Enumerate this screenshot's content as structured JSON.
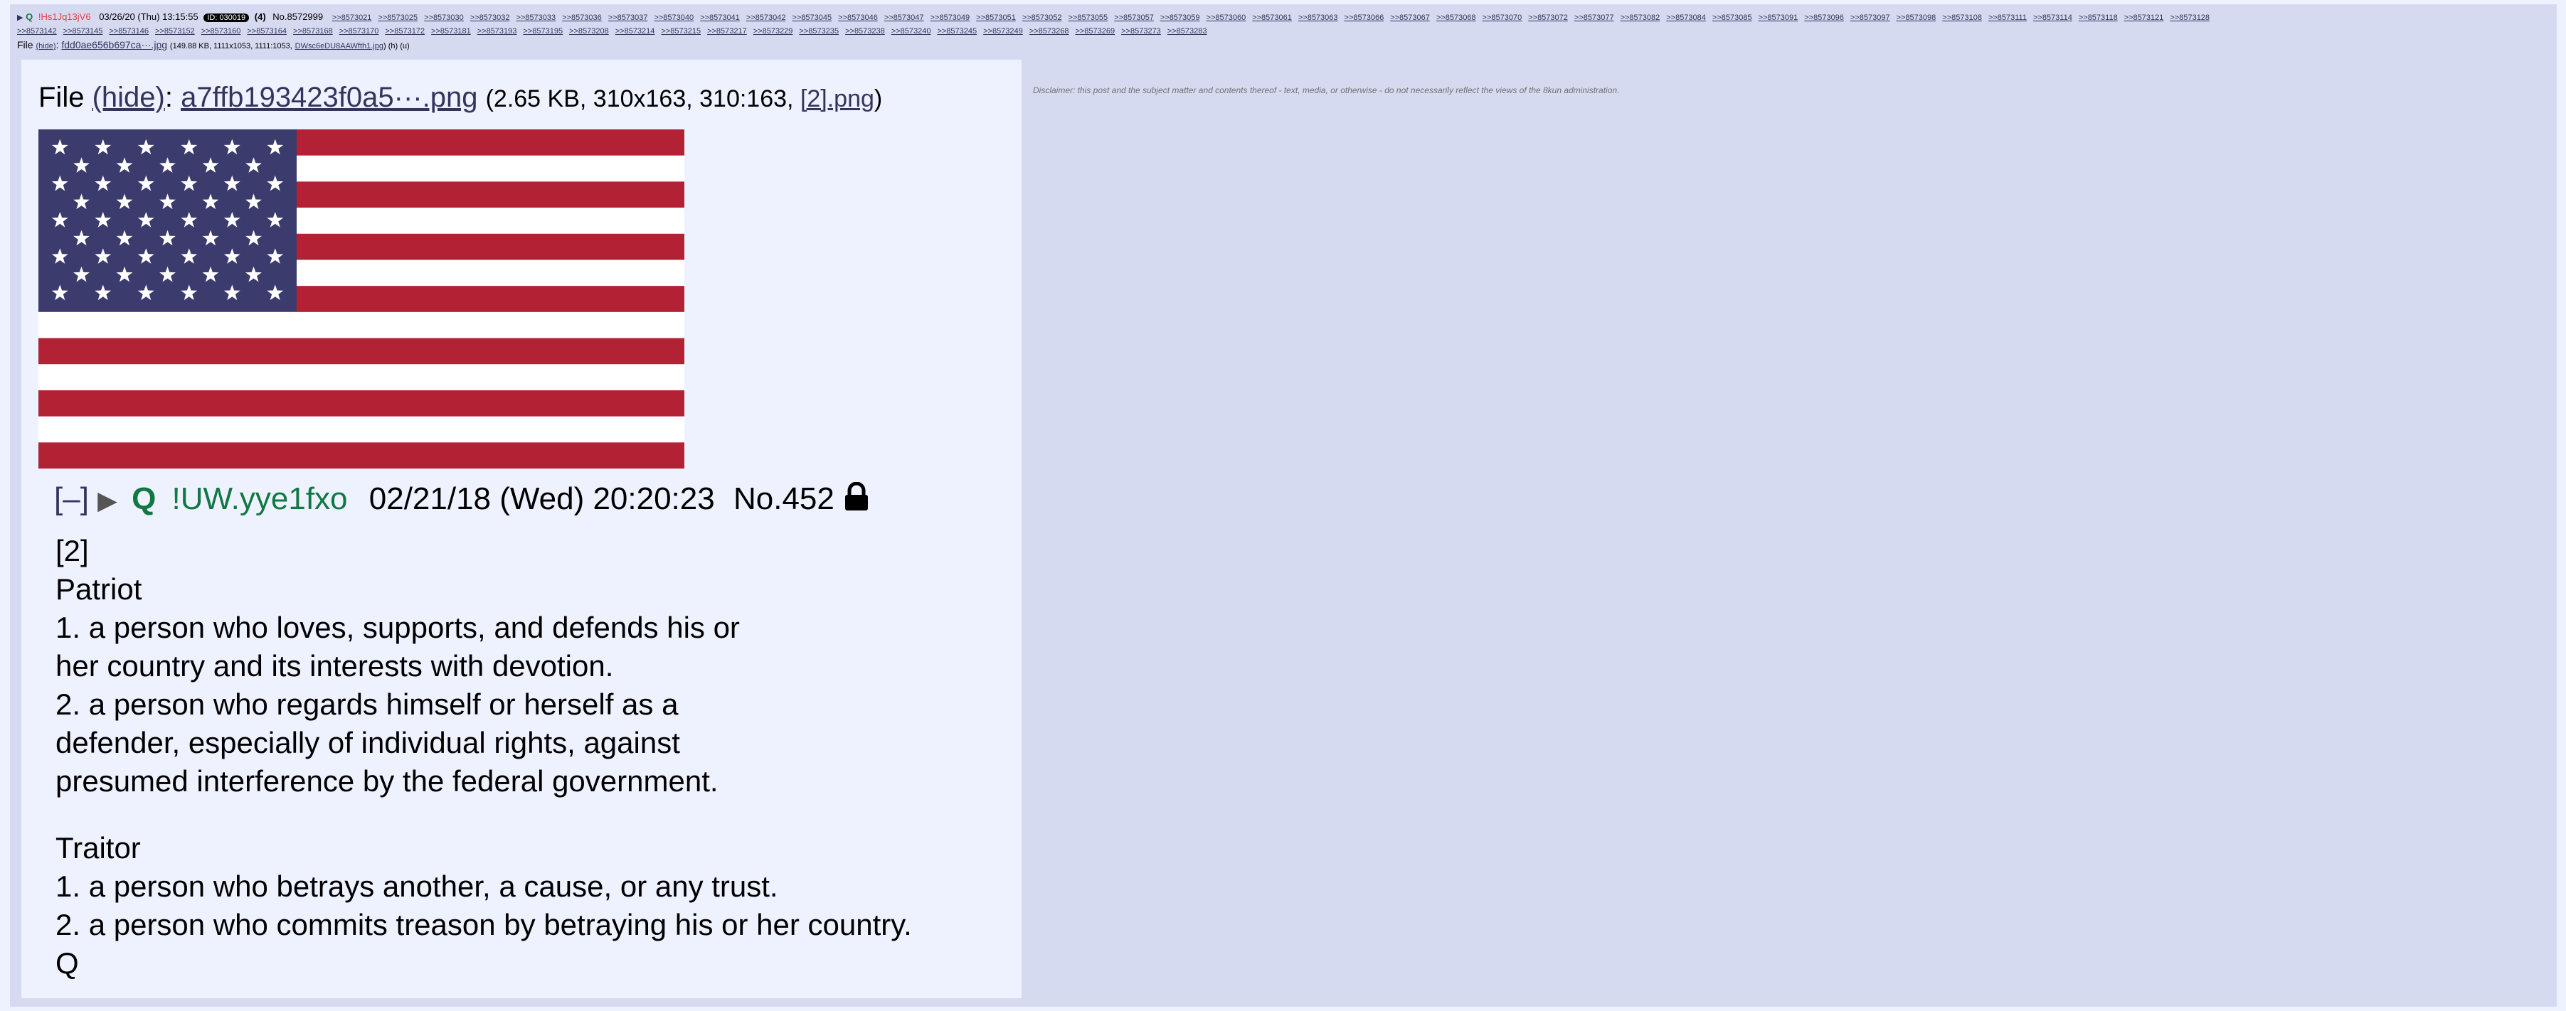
{
  "header": {
    "trip": "!Hs1Jq13jV6",
    "q_marker": "Q",
    "date": "03/26/20 (Thu) 13:15:55",
    "id_badge": "ID: 030019",
    "count": "(4)",
    "post_no": "No.8572999",
    "backlinks_row1": [
      ">>8573021",
      ">>8573025",
      ">>8573030",
      ">>8573032",
      ">>8573033",
      ">>8573036",
      ">>8573037",
      ">>8573040",
      ">>8573041",
      ">>8573042",
      ">>8573045",
      ">>8573046",
      ">>8573047",
      ">>8573049",
      ">>8573051",
      ">>8573052",
      ">>8573055",
      ">>8573057",
      ">>8573059",
      ">>8573060",
      ">>8573061",
      ">>8573063",
      ">>8573066",
      ">>8573067",
      ">>8573068",
      ">>8573070",
      ">>8573072",
      ">>8573077",
      ">>8573082",
      ">>8573084",
      ">>8573085",
      ">>8573091",
      ">>8573096",
      ">>8573097",
      ">>8573098",
      ">>8573108",
      ">>8573111",
      ">>8573114",
      ">>8573118",
      ">>8573121",
      ">>8573128"
    ],
    "backlinks_row2": [
      ">>8573142",
      ">>8573145",
      ">>8573146",
      ">>8573152",
      ">>8573160",
      ">>8573164",
      ">>8573168",
      ">>8573170",
      ">>8573172",
      ">>8573181",
      ">>8573193",
      ">>8573195",
      ">>8573208",
      ">>8573214",
      ">>8573215",
      ">>8573217",
      ">>8573229",
      ">>8573235",
      ">>8573238",
      ">>8573240",
      ">>8573245",
      ">>8573249",
      ">>8573268",
      ">>8573269",
      ">>8573273",
      ">>8573283"
    ],
    "file_line": {
      "prefix": "File",
      "hide": "(hide)",
      "fname": "fdd0ae656b697ca···.jpg",
      "meta": "(149.88 KB, 1111x1053, 1111:1053,",
      "orig": "DWsc6eDU8AAWfth1.jpg",
      "tail": ") (h) (u)"
    },
    "disclaimer": "Disclaimer: this post and the subject matter and contents thereof - text, media, or otherwise - do not necessarily reflect the views of the 8kun administration."
  },
  "reply": {
    "file_label": "File",
    "hide": "(hide)",
    "filename": "a7ffb193423f0a5···.png",
    "meta_prefix": "(2.65 KB, 310x163, 310:163,",
    "meta_link": "[2].png",
    "meta_suffix": ")",
    "image_alt": "flag-image",
    "collapse": "[–]",
    "q": "Q",
    "trip": "!UW.yye1fxo",
    "datetime": "02/21/18 (Wed) 20:20:23",
    "post_no": "No.452",
    "body_lines": [
      "[2]",
      "Patriot",
      "1. a person who loves, supports, and defends his or",
      "her country and its interests with devotion.",
      "2. a person who regards himself or herself as a",
      "defender, especially of individual rights, against",
      "presumed interference by the federal government."
    ],
    "body_lines2": [
      "Traitor",
      "1. a person who betrays another, a cause, or any trust.",
      "2. a person who commits treason by betraying his or her country.",
      "Q"
    ]
  },
  "colors": {
    "page_bg": "#eef2ff",
    "thread_bg": "#d6daf0",
    "link": "#34345c",
    "name_green": "#117743",
    "flag_red": "#b22234",
    "flag_blue": "#3c3b6e"
  }
}
